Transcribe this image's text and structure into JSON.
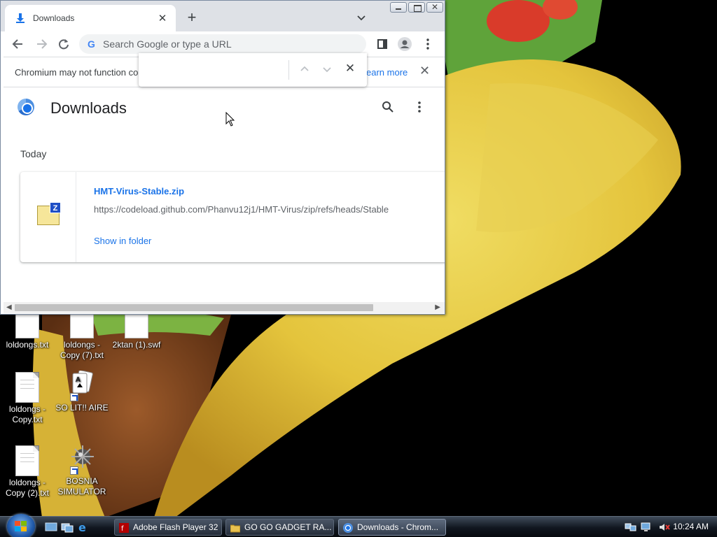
{
  "browser": {
    "tab_title": "Downloads",
    "omnibox_placeholder": "Search Google or type a URL",
    "infobar": {
      "message": "Chromium may not function co",
      "learn_more": "earn more"
    },
    "page": {
      "title": "Downloads",
      "section_date": "Today",
      "downloads": [
        {
          "filename": "HMT-Virus-Stable.zip",
          "url": "https://codeload.github.com/Phanvu12j1/HMT-Virus/zip/refs/heads/Stable",
          "action": "Show in folder"
        }
      ]
    }
  },
  "desktop": {
    "icons": [
      {
        "label": "loldongs.txt",
        "type": "text-file"
      },
      {
        "label": "loldongs - Copy (7).txt",
        "type": "text-file"
      },
      {
        "label": "2ktan (1).swf",
        "type": "swf-file"
      },
      {
        "label": "loldongs - Copy.txt",
        "type": "text-file"
      },
      {
        "label": "SO LIT!! AIRE",
        "type": "solitaire-shortcut"
      },
      {
        "label": "loldongs - Copy (2).txt",
        "type": "text-file"
      },
      {
        "label": "BOSNIA SIMULATOR",
        "type": "mine-shortcut"
      }
    ]
  },
  "taskbar": {
    "tasks": [
      {
        "label": "Adobe Flash Player 32",
        "icon": "flash-icon"
      },
      {
        "label": "GO GO GADGET RA...",
        "icon": "folder-icon"
      },
      {
        "label": "Downloads - Chrom...",
        "icon": "chromium-icon",
        "active": true
      }
    ],
    "clock": "10:24 AM"
  },
  "colors": {
    "link_blue": "#1a73e8",
    "tabstrip": "#dee1e6"
  }
}
